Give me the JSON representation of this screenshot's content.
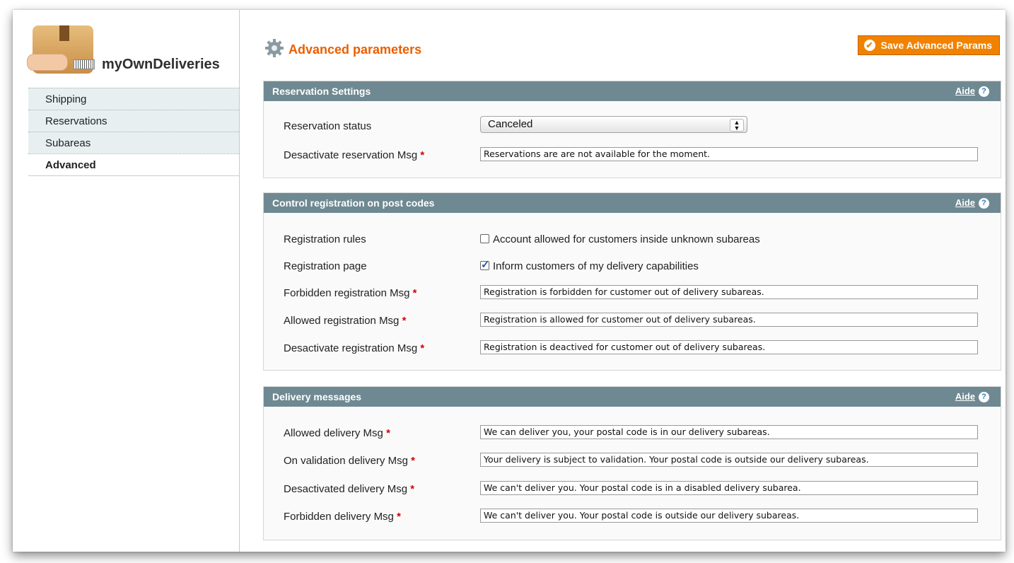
{
  "app": {
    "title": "myOwnDeliveries"
  },
  "nav": {
    "items": [
      "Shipping",
      "Reservations",
      "Subareas",
      "Advanced"
    ],
    "active": "Advanced"
  },
  "header": {
    "title": "Advanced parameters",
    "save_label": "Save Advanced Params"
  },
  "aide_label": "Aide",
  "sections": {
    "reservation": {
      "title": "Reservation Settings",
      "status_label": "Reservation status",
      "status_value": "Canceled",
      "msg_label": "Desactivate reservation Msg",
      "msg_value": "Reservations are are not available for the moment."
    },
    "registration": {
      "title": "Control registration on post codes",
      "rules_label": "Registration rules",
      "rules_checkbox": "Account allowed for customers inside unknown subareas",
      "rules_checked": false,
      "page_label": "Registration page",
      "page_checkbox": "Inform customers of my delivery capabilities",
      "page_checked": true,
      "forbidden_label": "Forbidden registration Msg",
      "forbidden_value": "Registration is forbidden for customer out of delivery subareas.",
      "allowed_label": "Allowed registration Msg",
      "allowed_value": "Registration is allowed for customer out of delivery subareas.",
      "deactivate_label": "Desactivate registration Msg",
      "deactivate_value": "Registration is deactived for customer out of delivery subareas."
    },
    "delivery": {
      "title": "Delivery messages",
      "allowed_label": "Allowed delivery Msg",
      "allowed_value": "We can deliver you, your postal code is in our delivery subareas.",
      "validation_label": "On validation delivery Msg",
      "validation_value": "Your delivery is subject to validation. Your postal code is outside our delivery subareas.",
      "deactivated_label": "Desactivated delivery Msg",
      "deactivated_value": "We can't deliver you. Your postal code is in a disabled delivery subarea.",
      "forbidden_label": "Forbidden delivery Msg",
      "forbidden_value": "We can't deliver you. Your postal code is outside our delivery subareas."
    }
  },
  "required_mark": "*",
  "colors": {
    "accent": "#eb5e00",
    "button": "#f18200",
    "section_header": "#6f8992",
    "nav_bg": "#e7eff0"
  }
}
